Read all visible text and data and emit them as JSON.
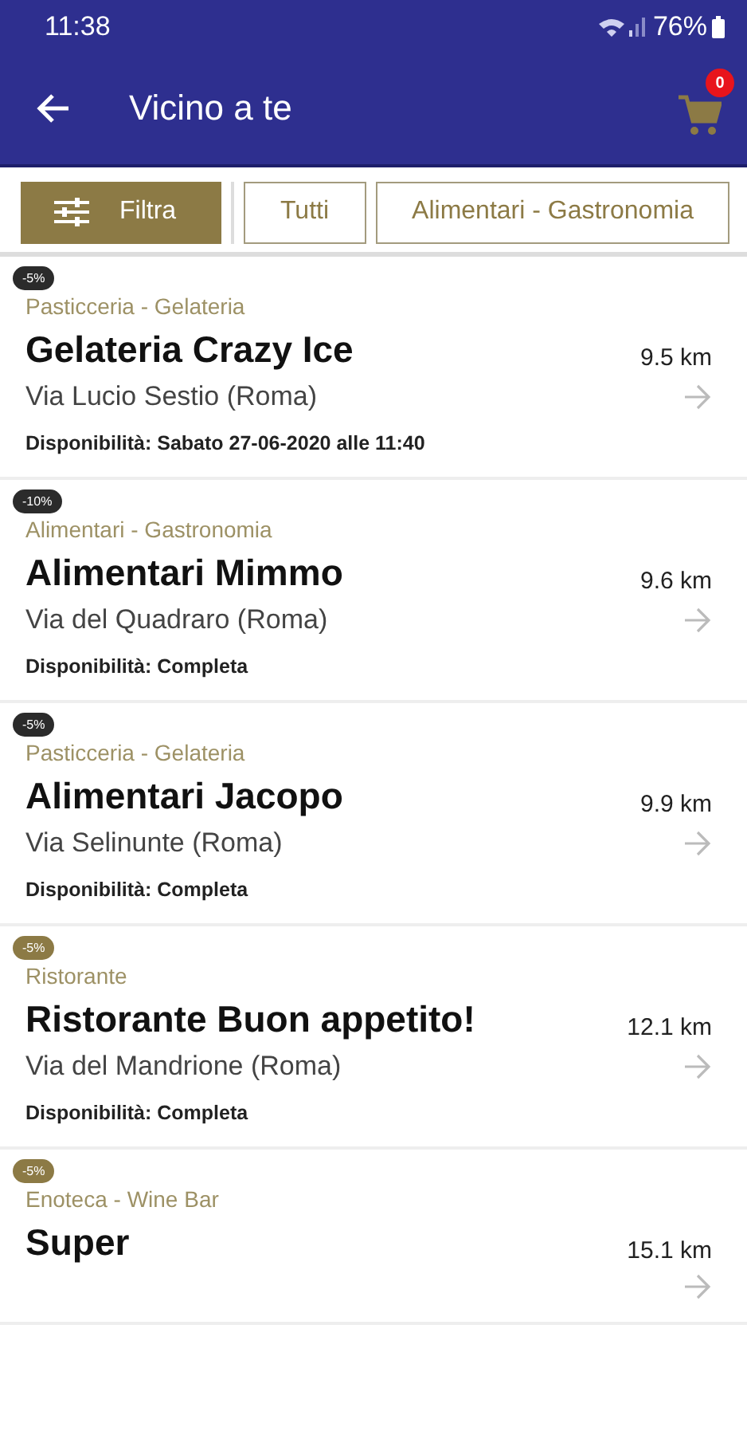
{
  "status_bar": {
    "time": "11:38",
    "battery": "76%"
  },
  "app_bar": {
    "title": "Vicino a te",
    "cart_count": "0"
  },
  "filters": {
    "button": "Filtra",
    "chips": [
      "Tutti",
      "Alimentari - Gastronomia"
    ]
  },
  "stores": [
    {
      "discount": "-5%",
      "color": "#2b2b2b",
      "category": "Pasticceria - Gelateria",
      "name": "Gelateria Crazy Ice",
      "distance": "9.5 km",
      "address": "Via Lucio Sestio (Roma)",
      "availability": "Disponibilità: Sabato 27-06-2020 alle 11:40"
    },
    {
      "discount": "-10%",
      "color": "#2b2b2b",
      "category": "Alimentari - Gastronomia",
      "name": "Alimentari Mimmo",
      "distance": "9.6 km",
      "address": "Via del Quadraro (Roma)",
      "availability": "Disponibilità: Completa"
    },
    {
      "discount": "-5%",
      "color": "#2b2b2b",
      "category": "Pasticceria - Gelateria",
      "name": "Alimentari Jacopo",
      "distance": "9.9 km",
      "address": "Via Selinunte (Roma)",
      "availability": "Disponibilità: Completa"
    },
    {
      "discount": "-5%",
      "color": "#8c7a45",
      "category": "Ristorante",
      "name": "Ristorante Buon appetito!",
      "distance": "12.1 km",
      "address": "Via del Mandrione (Roma)",
      "availability": "Disponibilità: Completa"
    },
    {
      "discount": "-5%",
      "color": "#8c7a45",
      "category": "Enoteca - Wine Bar",
      "name": "Super",
      "distance": "15.1 km"
    }
  ]
}
